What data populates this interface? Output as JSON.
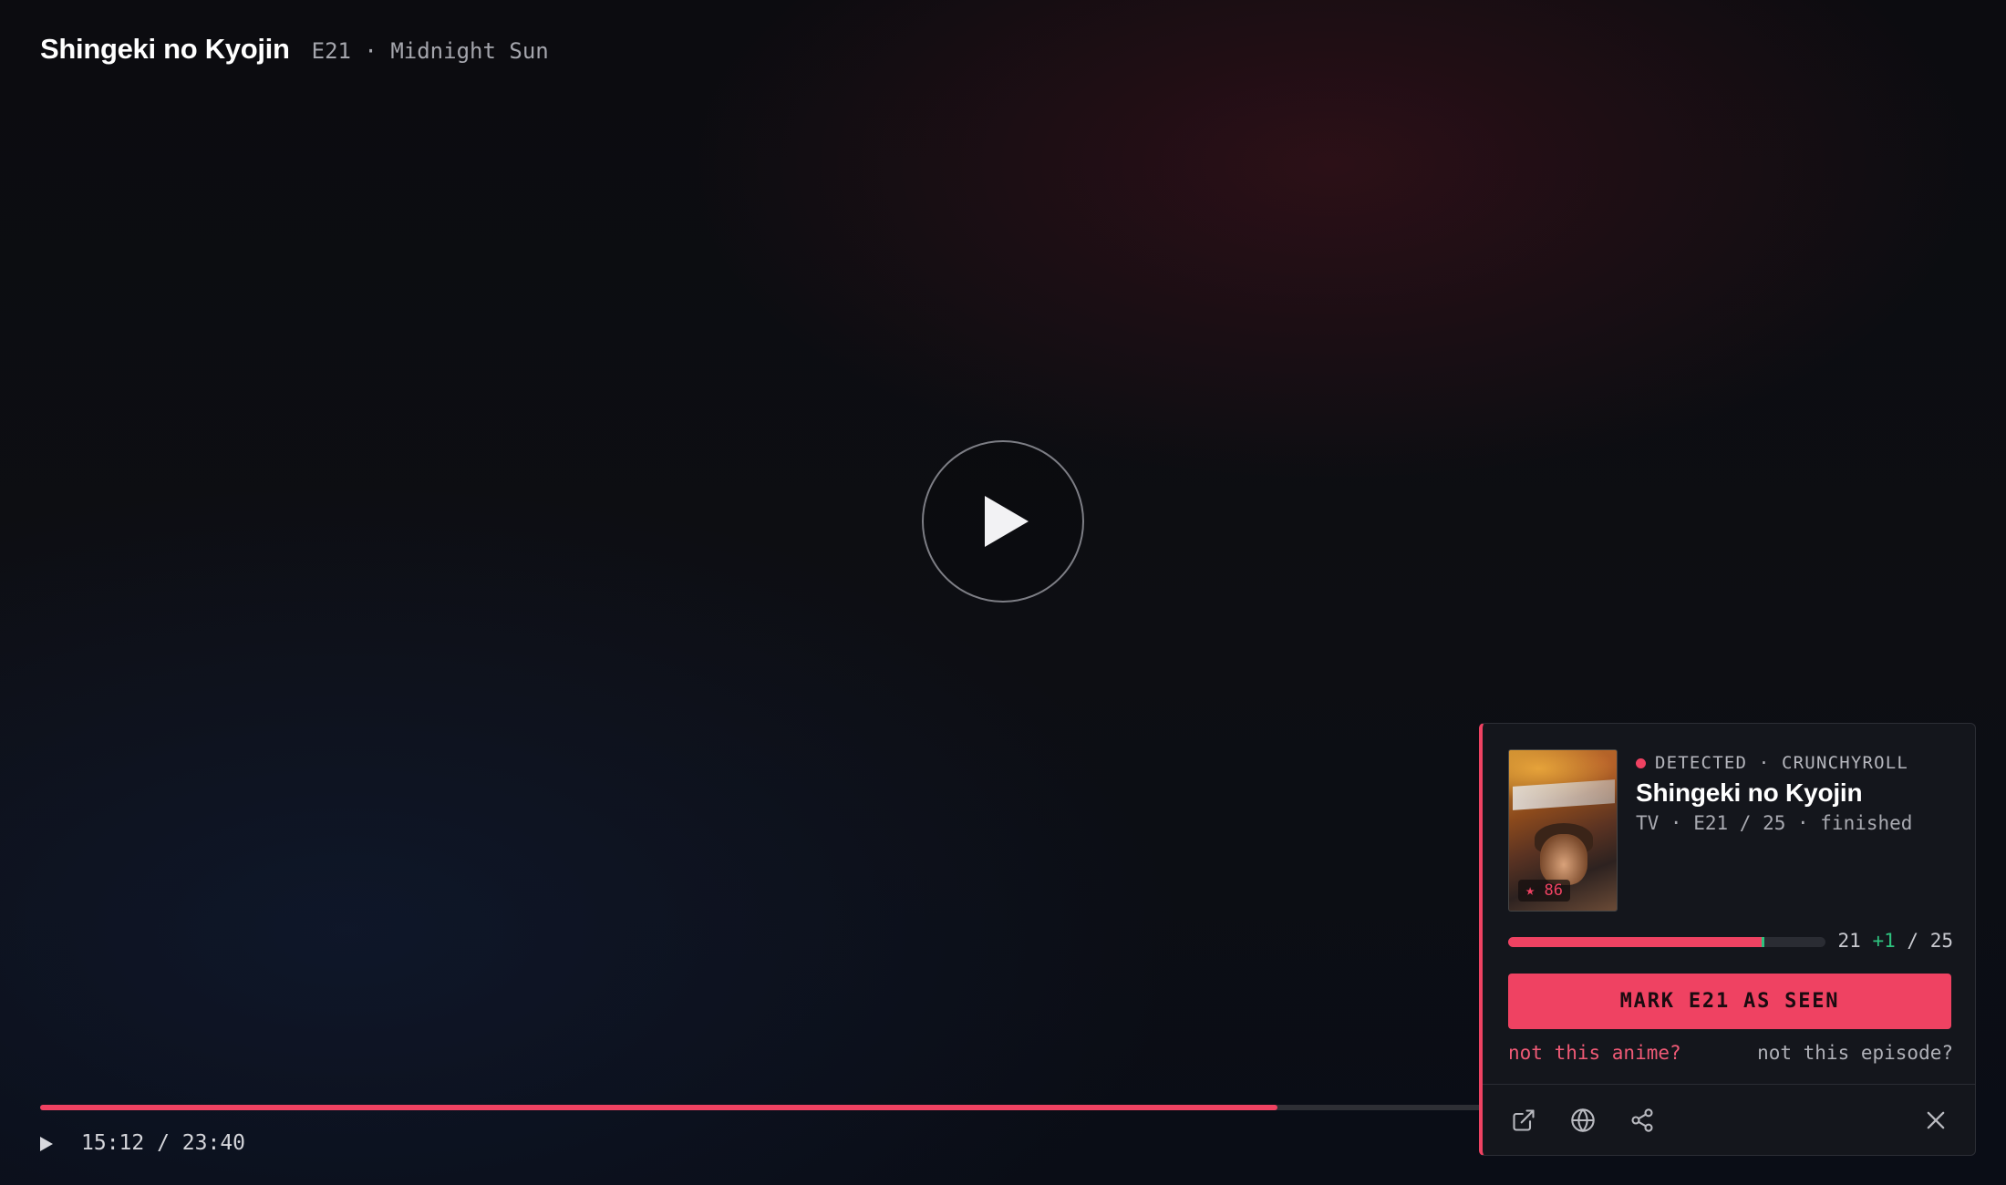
{
  "header": {
    "title": "Shingeki no Kyojin",
    "episode_subtitle": "E21 · Midnight Sun"
  },
  "player": {
    "time_label": "15:12 / 23:40",
    "progress_fraction": 0.6423,
    "big_play_icon": "play-icon",
    "control_play_icon": "play-icon"
  },
  "popup": {
    "status_label": "DETECTED · CRUNCHYROLL",
    "title": "Shingeki no Kyojin",
    "meta": "TV · E21 / 25 · finished",
    "poster_score": "★ 86",
    "episodes_seen": 20,
    "episode_current_label": "21",
    "episode_increment_label": "+1",
    "episode_total_label": "/ 25",
    "episodes_total": 25,
    "mark_button_label": "MARK E21 AS SEEN",
    "not_anime_label": "not this anime?",
    "not_episode_label": "not this episode?",
    "footer_icons": [
      "external-link-icon",
      "globe-icon",
      "share-icon",
      "close-icon"
    ]
  },
  "colors": {
    "accent": "#ef4262",
    "success": "#2ec27e",
    "panel": "#14161c"
  }
}
